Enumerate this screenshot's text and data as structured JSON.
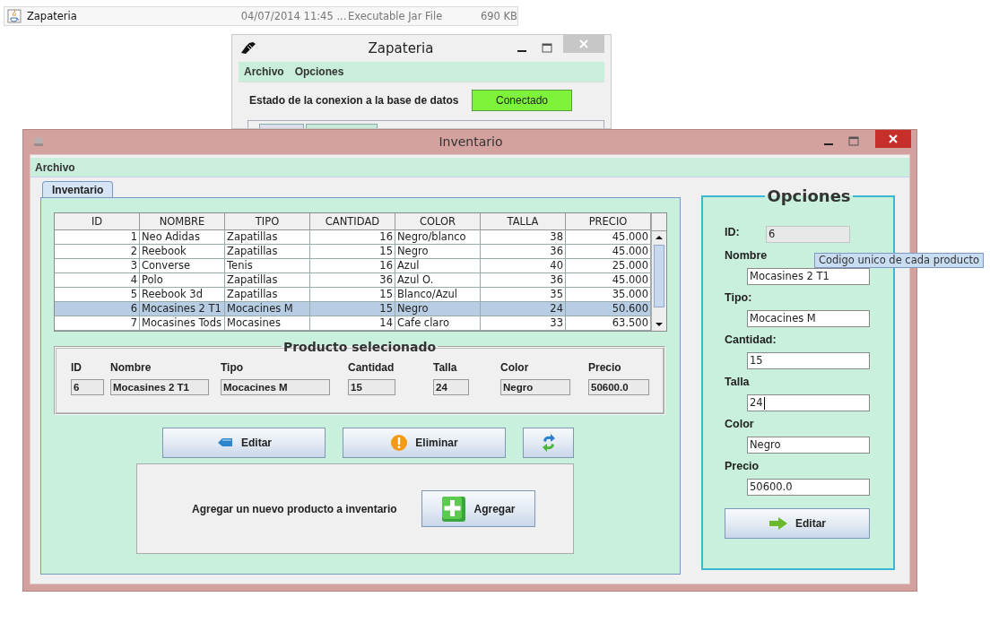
{
  "explorer_row": {
    "name": "Zapateria",
    "date_modified": "04/07/2014 11:45 ...",
    "type": "Executable Jar File",
    "size": "690 KB"
  },
  "back_window": {
    "title": "Zapateria",
    "menu": [
      "Archivo",
      "Opciones"
    ],
    "status_label": "Estado de la conexion a la base de datos",
    "status_value": "Conectado",
    "connected": true
  },
  "window": {
    "title": "Inventario",
    "menu": [
      "Archivo"
    ],
    "tabs": [
      {
        "label": "Inventario",
        "selected": true
      }
    ]
  },
  "table": {
    "columns": [
      {
        "label": "ID",
        "numeric": true
      },
      {
        "label": "NOMBRE",
        "numeric": false
      },
      {
        "label": "TIPO",
        "numeric": false
      },
      {
        "label": "CANTIDAD",
        "numeric": true
      },
      {
        "label": "COLOR",
        "numeric": false
      },
      {
        "label": "TALLA",
        "numeric": true
      },
      {
        "label": "PRECIO",
        "numeric": true
      }
    ],
    "rows": [
      {
        "cells": [
          "1",
          "Neo Adidas",
          "Zapatillas",
          "16",
          "Negro/blanco",
          "38",
          "45.000"
        ],
        "selected": false
      },
      {
        "cells": [
          "2",
          "Reebook",
          "Zapatillas",
          "15",
          "Negro",
          "36",
          "45.000"
        ],
        "selected": false
      },
      {
        "cells": [
          "3",
          "Converse",
          "Tenis",
          "16",
          "Azul",
          "40",
          "25.000"
        ],
        "selected": false
      },
      {
        "cells": [
          "4",
          "Polo",
          "Zapatillas",
          "36",
          "Azul O.",
          "36",
          "45.000"
        ],
        "selected": false
      },
      {
        "cells": [
          "5",
          "Reebook 3d",
          "Zapatillas",
          "15",
          "Blanco/Azul",
          "35",
          "35.000"
        ],
        "selected": false
      },
      {
        "cells": [
          "6",
          "Mocasines 2 T1",
          "Mocacines M",
          "15",
          "Negro",
          "24",
          "50.600"
        ],
        "selected": true
      },
      {
        "cells": [
          "7",
          "Mocasines Tods",
          "Mocasines",
          "14",
          "Cafe claro",
          "33",
          "63.500"
        ],
        "selected": false
      }
    ]
  },
  "selected_product": {
    "title": "Producto selecionado",
    "fields": [
      {
        "label": "ID",
        "value": "6"
      },
      {
        "label": "Nombre",
        "value": "Mocasines 2 T1"
      },
      {
        "label": "Tipo",
        "value": "Mocacines M"
      },
      {
        "label": "Cantidad",
        "value": "15"
      },
      {
        "label": "Talla",
        "value": "24"
      },
      {
        "label": "Color",
        "value": "Negro"
      },
      {
        "label": "Precio",
        "value": "50600.0"
      }
    ]
  },
  "buttons": [
    {
      "kind": "edit",
      "label": "Editar"
    },
    {
      "kind": "delete",
      "label": "Eliminar"
    },
    {
      "kind": "refresh"
    }
  ],
  "add_panel": {
    "text": "Agregar un nuevo producto a inventario",
    "button": "Agregar"
  },
  "options": {
    "title": "Opciones",
    "fields": [
      {
        "label": "ID:",
        "value": "6",
        "disabled": true,
        "focused": false
      },
      {
        "label": "Nombre",
        "value": "Mocasines 2 T1",
        "disabled": false,
        "focused": false
      },
      {
        "label": "Tipo:",
        "value": "Mocacines M",
        "disabled": false,
        "focused": false
      },
      {
        "label": "Cantidad:",
        "value": "15",
        "disabled": false,
        "focused": false
      },
      {
        "label": "Talla",
        "value": "24",
        "disabled": false,
        "focused": true
      },
      {
        "label": "Color",
        "value": "Negro",
        "disabled": false,
        "focused": false
      },
      {
        "label": "Precio",
        "value": "50600.0",
        "disabled": false,
        "focused": false
      }
    ],
    "button": "Editar"
  },
  "tooltip": "Codigo unico de cada producto"
}
